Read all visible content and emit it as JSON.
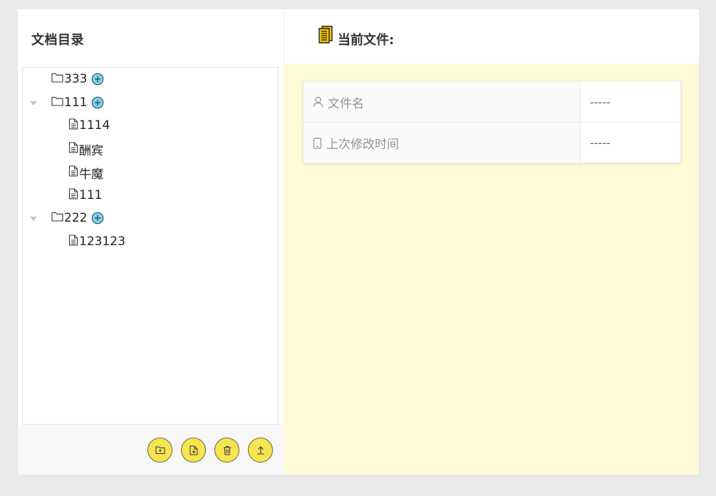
{
  "sidebar": {
    "title": "文档目录",
    "tree": [
      {
        "type": "folder",
        "label": "333",
        "expandable": false,
        "has_add": true
      },
      {
        "type": "folder",
        "label": "111",
        "expandable": true,
        "has_add": true
      },
      {
        "type": "file",
        "label": "1114"
      },
      {
        "type": "file",
        "label": "酬宾"
      },
      {
        "type": "file",
        "label": "牛魔"
      },
      {
        "type": "file",
        "label": "111"
      },
      {
        "type": "folder",
        "label": "222",
        "expandable": true,
        "has_add": true
      },
      {
        "type": "file",
        "label": "123123"
      }
    ],
    "footer_buttons": [
      {
        "icon": "new-folder-icon"
      },
      {
        "icon": "new-file-icon"
      },
      {
        "icon": "trash-icon"
      },
      {
        "icon": "upload-icon"
      }
    ]
  },
  "main": {
    "title": "当前文件:",
    "title_icon": "document-icon",
    "info": {
      "file_name_label": "文件名",
      "file_name_value": "-----",
      "modified_label": "上次修改时间",
      "modified_value": "-----"
    }
  },
  "colors": {
    "accent_yellow": "#f5e553",
    "main_background": "#fffad6",
    "add_button": "#7fd3ea"
  }
}
